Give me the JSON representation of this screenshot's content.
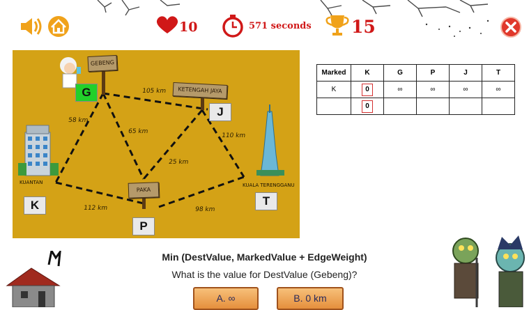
{
  "hud": {
    "lives": "10",
    "timer": "571 seconds",
    "score": "15",
    "sound_icon": "speaker-icon",
    "home_icon": "home-icon",
    "close_icon": "close-icon",
    "colors": {
      "accent": "#d01818",
      "map": "#d4a216",
      "button": "#e58f3c",
      "active_node": "#22d02a"
    }
  },
  "map": {
    "nodes": {
      "G": {
        "letter": "G",
        "sign": "GEBENG"
      },
      "J": {
        "letter": "J",
        "sign": "KETENGAH JAYA"
      },
      "K": {
        "letter": "K",
        "sign": "KUANTAN"
      },
      "P": {
        "letter": "P",
        "sign": "PAKA"
      },
      "T": {
        "letter": "T",
        "sign": "KUALA TERENGGANU"
      }
    },
    "edges": {
      "GJ": "105 km",
      "GK": "58 km",
      "GP": "65 km",
      "JP": "25 km",
      "JT": "110 km",
      "KP": "112 km",
      "PT": "98 km"
    }
  },
  "table": {
    "headers": [
      "Marked",
      "K",
      "G",
      "P",
      "J",
      "T"
    ],
    "rows": [
      [
        "K",
        "0",
        "∞",
        "∞",
        "∞",
        "∞"
      ],
      [
        "",
        "0",
        "",
        "",
        "",
        ""
      ]
    ]
  },
  "question": {
    "formula": "Min (DestValue, MarkedValue + EdgeWeight)",
    "text": "What is the value for DestValue (Gebeng)?"
  },
  "answers": {
    "a": "A. ∞",
    "b": "B. 0 km"
  }
}
